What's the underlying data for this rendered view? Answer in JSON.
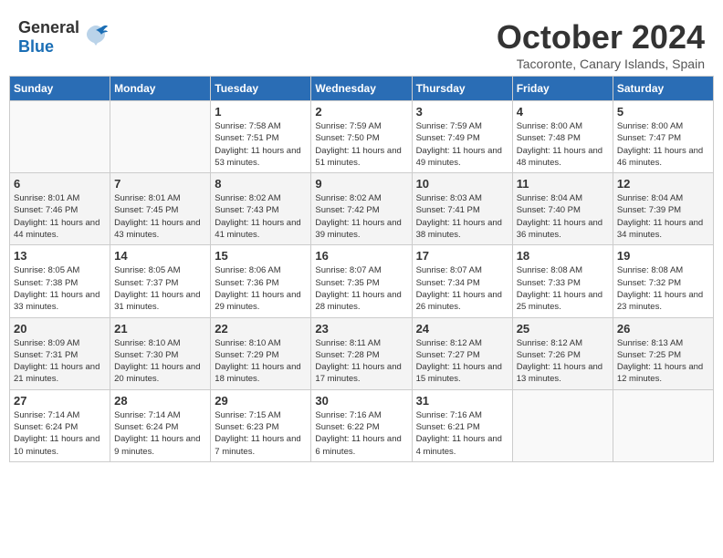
{
  "header": {
    "logo_general": "General",
    "logo_blue": "Blue",
    "title": "October 2024",
    "location": "Tacoronte, Canary Islands, Spain"
  },
  "days_of_week": [
    "Sunday",
    "Monday",
    "Tuesday",
    "Wednesday",
    "Thursday",
    "Friday",
    "Saturday"
  ],
  "weeks": [
    [
      {
        "day": "",
        "sunrise": "",
        "sunset": "",
        "daylight": ""
      },
      {
        "day": "",
        "sunrise": "",
        "sunset": "",
        "daylight": ""
      },
      {
        "day": "1",
        "sunrise": "Sunrise: 7:58 AM",
        "sunset": "Sunset: 7:51 PM",
        "daylight": "Daylight: 11 hours and 53 minutes."
      },
      {
        "day": "2",
        "sunrise": "Sunrise: 7:59 AM",
        "sunset": "Sunset: 7:50 PM",
        "daylight": "Daylight: 11 hours and 51 minutes."
      },
      {
        "day": "3",
        "sunrise": "Sunrise: 7:59 AM",
        "sunset": "Sunset: 7:49 PM",
        "daylight": "Daylight: 11 hours and 49 minutes."
      },
      {
        "day": "4",
        "sunrise": "Sunrise: 8:00 AM",
        "sunset": "Sunset: 7:48 PM",
        "daylight": "Daylight: 11 hours and 48 minutes."
      },
      {
        "day": "5",
        "sunrise": "Sunrise: 8:00 AM",
        "sunset": "Sunset: 7:47 PM",
        "daylight": "Daylight: 11 hours and 46 minutes."
      }
    ],
    [
      {
        "day": "6",
        "sunrise": "Sunrise: 8:01 AM",
        "sunset": "Sunset: 7:46 PM",
        "daylight": "Daylight: 11 hours and 44 minutes."
      },
      {
        "day": "7",
        "sunrise": "Sunrise: 8:01 AM",
        "sunset": "Sunset: 7:45 PM",
        "daylight": "Daylight: 11 hours and 43 minutes."
      },
      {
        "day": "8",
        "sunrise": "Sunrise: 8:02 AM",
        "sunset": "Sunset: 7:43 PM",
        "daylight": "Daylight: 11 hours and 41 minutes."
      },
      {
        "day": "9",
        "sunrise": "Sunrise: 8:02 AM",
        "sunset": "Sunset: 7:42 PM",
        "daylight": "Daylight: 11 hours and 39 minutes."
      },
      {
        "day": "10",
        "sunrise": "Sunrise: 8:03 AM",
        "sunset": "Sunset: 7:41 PM",
        "daylight": "Daylight: 11 hours and 38 minutes."
      },
      {
        "day": "11",
        "sunrise": "Sunrise: 8:04 AM",
        "sunset": "Sunset: 7:40 PM",
        "daylight": "Daylight: 11 hours and 36 minutes."
      },
      {
        "day": "12",
        "sunrise": "Sunrise: 8:04 AM",
        "sunset": "Sunset: 7:39 PM",
        "daylight": "Daylight: 11 hours and 34 minutes."
      }
    ],
    [
      {
        "day": "13",
        "sunrise": "Sunrise: 8:05 AM",
        "sunset": "Sunset: 7:38 PM",
        "daylight": "Daylight: 11 hours and 33 minutes."
      },
      {
        "day": "14",
        "sunrise": "Sunrise: 8:05 AM",
        "sunset": "Sunset: 7:37 PM",
        "daylight": "Daylight: 11 hours and 31 minutes."
      },
      {
        "day": "15",
        "sunrise": "Sunrise: 8:06 AM",
        "sunset": "Sunset: 7:36 PM",
        "daylight": "Daylight: 11 hours and 29 minutes."
      },
      {
        "day": "16",
        "sunrise": "Sunrise: 8:07 AM",
        "sunset": "Sunset: 7:35 PM",
        "daylight": "Daylight: 11 hours and 28 minutes."
      },
      {
        "day": "17",
        "sunrise": "Sunrise: 8:07 AM",
        "sunset": "Sunset: 7:34 PM",
        "daylight": "Daylight: 11 hours and 26 minutes."
      },
      {
        "day": "18",
        "sunrise": "Sunrise: 8:08 AM",
        "sunset": "Sunset: 7:33 PM",
        "daylight": "Daylight: 11 hours and 25 minutes."
      },
      {
        "day": "19",
        "sunrise": "Sunrise: 8:08 AM",
        "sunset": "Sunset: 7:32 PM",
        "daylight": "Daylight: 11 hours and 23 minutes."
      }
    ],
    [
      {
        "day": "20",
        "sunrise": "Sunrise: 8:09 AM",
        "sunset": "Sunset: 7:31 PM",
        "daylight": "Daylight: 11 hours and 21 minutes."
      },
      {
        "day": "21",
        "sunrise": "Sunrise: 8:10 AM",
        "sunset": "Sunset: 7:30 PM",
        "daylight": "Daylight: 11 hours and 20 minutes."
      },
      {
        "day": "22",
        "sunrise": "Sunrise: 8:10 AM",
        "sunset": "Sunset: 7:29 PM",
        "daylight": "Daylight: 11 hours and 18 minutes."
      },
      {
        "day": "23",
        "sunrise": "Sunrise: 8:11 AM",
        "sunset": "Sunset: 7:28 PM",
        "daylight": "Daylight: 11 hours and 17 minutes."
      },
      {
        "day": "24",
        "sunrise": "Sunrise: 8:12 AM",
        "sunset": "Sunset: 7:27 PM",
        "daylight": "Daylight: 11 hours and 15 minutes."
      },
      {
        "day": "25",
        "sunrise": "Sunrise: 8:12 AM",
        "sunset": "Sunset: 7:26 PM",
        "daylight": "Daylight: 11 hours and 13 minutes."
      },
      {
        "day": "26",
        "sunrise": "Sunrise: 8:13 AM",
        "sunset": "Sunset: 7:25 PM",
        "daylight": "Daylight: 11 hours and 12 minutes."
      }
    ],
    [
      {
        "day": "27",
        "sunrise": "Sunrise: 7:14 AM",
        "sunset": "Sunset: 6:24 PM",
        "daylight": "Daylight: 11 hours and 10 minutes."
      },
      {
        "day": "28",
        "sunrise": "Sunrise: 7:14 AM",
        "sunset": "Sunset: 6:24 PM",
        "daylight": "Daylight: 11 hours and 9 minutes."
      },
      {
        "day": "29",
        "sunrise": "Sunrise: 7:15 AM",
        "sunset": "Sunset: 6:23 PM",
        "daylight": "Daylight: 11 hours and 7 minutes."
      },
      {
        "day": "30",
        "sunrise": "Sunrise: 7:16 AM",
        "sunset": "Sunset: 6:22 PM",
        "daylight": "Daylight: 11 hours and 6 minutes."
      },
      {
        "day": "31",
        "sunrise": "Sunrise: 7:16 AM",
        "sunset": "Sunset: 6:21 PM",
        "daylight": "Daylight: 11 hours and 4 minutes."
      },
      {
        "day": "",
        "sunrise": "",
        "sunset": "",
        "daylight": ""
      },
      {
        "day": "",
        "sunrise": "",
        "sunset": "",
        "daylight": ""
      }
    ]
  ]
}
